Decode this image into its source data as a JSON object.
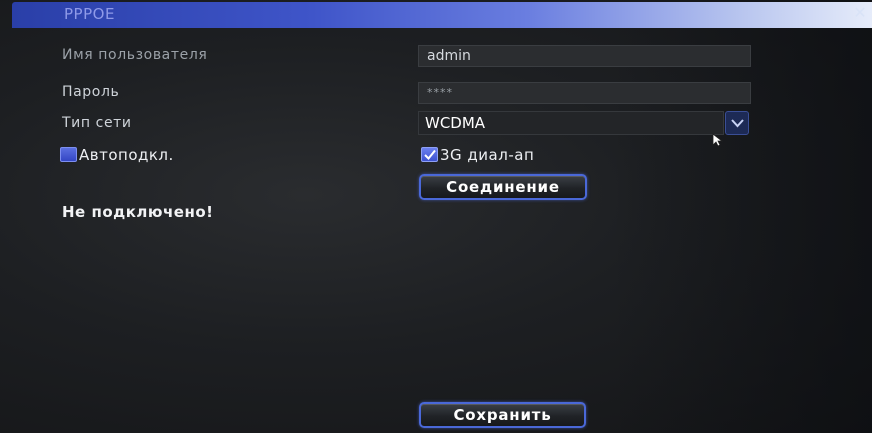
{
  "window": {
    "title": "PPPOE",
    "close_icon": "close-icon"
  },
  "form": {
    "username_label": "Имя пользователя",
    "username_value": "admin",
    "password_label": "Пароль",
    "password_value": "****",
    "network_type_label": "Тип сети",
    "network_type_value": "WCDMA",
    "auto_connect_label": "Автоподкл.",
    "auto_connect_checked": false,
    "dialup_3g_label": "3G диал-ап",
    "dialup_3g_checked": true,
    "connect_button": "Соединение"
  },
  "status": {
    "text": "Не подключено!"
  },
  "footer": {
    "save_button": "Сохранить"
  },
  "colors": {
    "title_bar": "#3f55c9",
    "accent_border": "#4a68d8",
    "checkbox_fill": "#4a5fe0",
    "background": "#1d1f22"
  }
}
